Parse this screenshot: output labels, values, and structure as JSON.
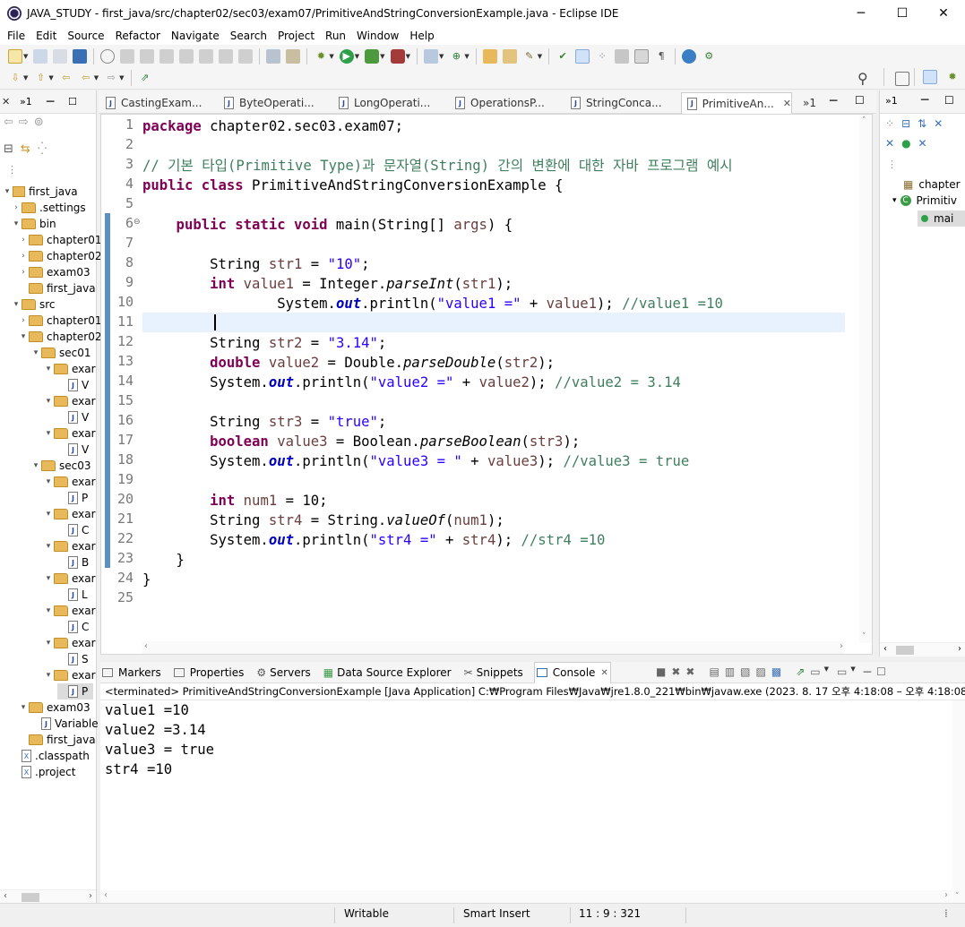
{
  "window": {
    "title": "JAVA_STUDY - first_java/src/chapter02/sec03/exam07/PrimitiveAndStringConversionExample.java - Eclipse IDE",
    "minimize": "─",
    "maximize": "☐",
    "close": "✕"
  },
  "menu": [
    "File",
    "Edit",
    "Source",
    "Refactor",
    "Navigate",
    "Search",
    "Project",
    "Run",
    "Window",
    "Help"
  ],
  "explorer": {
    "tab_glyph": "»1",
    "items": [
      {
        "label": "first_java",
        "depth": 0,
        "kind": "project",
        "twisty": "▾"
      },
      {
        "label": ".settings",
        "depth": 1,
        "kind": "folder",
        "twisty": "›"
      },
      {
        "label": "bin",
        "depth": 1,
        "kind": "folder",
        "twisty": "▾"
      },
      {
        "label": "chapter01",
        "depth": 2,
        "kind": "folder",
        "twisty": "›"
      },
      {
        "label": "chapter02",
        "depth": 2,
        "kind": "folder",
        "twisty": "›"
      },
      {
        "label": "exam03",
        "depth": 2,
        "kind": "folder",
        "twisty": "›"
      },
      {
        "label": "first_java",
        "depth": 2,
        "kind": "folder",
        "twisty": ""
      },
      {
        "label": "src",
        "depth": 1,
        "kind": "folder",
        "twisty": "▾"
      },
      {
        "label": "chapter01",
        "depth": 2,
        "kind": "folder",
        "twisty": "›"
      },
      {
        "label": "chapter02",
        "depth": 2,
        "kind": "folder",
        "twisty": "▾"
      },
      {
        "label": "sec01",
        "depth": 3,
        "kind": "folder",
        "twisty": "▾"
      },
      {
        "label": "exar",
        "depth": 4,
        "kind": "folder",
        "twisty": "▾"
      },
      {
        "label": "V",
        "depth": 5,
        "kind": "java",
        "twisty": ""
      },
      {
        "label": "exar",
        "depth": 4,
        "kind": "folder",
        "twisty": "▾"
      },
      {
        "label": "V",
        "depth": 5,
        "kind": "java",
        "twisty": ""
      },
      {
        "label": "exar",
        "depth": 4,
        "kind": "folder",
        "twisty": "▾"
      },
      {
        "label": "V",
        "depth": 5,
        "kind": "java",
        "twisty": ""
      },
      {
        "label": "sec03",
        "depth": 3,
        "kind": "folder",
        "twisty": "▾"
      },
      {
        "label": "exar",
        "depth": 4,
        "kind": "folder",
        "twisty": "▾"
      },
      {
        "label": "P",
        "depth": 5,
        "kind": "java",
        "twisty": ""
      },
      {
        "label": "exar",
        "depth": 4,
        "kind": "folder",
        "twisty": "▾"
      },
      {
        "label": "C",
        "depth": 5,
        "kind": "java",
        "twisty": ""
      },
      {
        "label": "exar",
        "depth": 4,
        "kind": "folder",
        "twisty": "▾"
      },
      {
        "label": "B",
        "depth": 5,
        "kind": "java",
        "twisty": ""
      },
      {
        "label": "exar",
        "depth": 4,
        "kind": "folder",
        "twisty": "▾"
      },
      {
        "label": "L",
        "depth": 5,
        "kind": "java",
        "twisty": ""
      },
      {
        "label": "exar",
        "depth": 4,
        "kind": "folder",
        "twisty": "▾"
      },
      {
        "label": "C",
        "depth": 5,
        "kind": "java",
        "twisty": ""
      },
      {
        "label": "exar",
        "depth": 4,
        "kind": "folder",
        "twisty": "▾"
      },
      {
        "label": "S",
        "depth": 5,
        "kind": "java",
        "twisty": ""
      },
      {
        "label": "exar",
        "depth": 4,
        "kind": "folder",
        "twisty": "▾"
      },
      {
        "label": "P",
        "depth": 5,
        "kind": "java",
        "twisty": "",
        "selected": true
      },
      {
        "label": "exam03",
        "depth": 2,
        "kind": "folder",
        "twisty": "▾"
      },
      {
        "label": "Variable",
        "depth": 3,
        "kind": "java",
        "twisty": ""
      },
      {
        "label": "first_java",
        "depth": 2,
        "kind": "folder",
        "twisty": ""
      },
      {
        "label": ".classpath",
        "depth": 1,
        "kind": "xml",
        "twisty": ""
      },
      {
        "label": ".project",
        "depth": 1,
        "kind": "xml",
        "twisty": ""
      }
    ]
  },
  "editor_tabs": [
    {
      "label": "CastingExam...",
      "active": false
    },
    {
      "label": "ByteOperati...",
      "active": false
    },
    {
      "label": "LongOperati...",
      "active": false
    },
    {
      "label": "OperationsP...",
      "active": false
    },
    {
      "label": "StringConca...",
      "active": false
    },
    {
      "label": "PrimitiveAn...",
      "active": true,
      "close": "✕"
    },
    {
      "label": "»1",
      "active": false
    }
  ],
  "code": [
    "1",
    "2",
    "3",
    "4",
    "5",
    "6",
    "7",
    "8",
    "9",
    "10",
    "11",
    "12",
    "13",
    "14",
    "15",
    "16",
    "17",
    "18",
    "19",
    "20",
    "21",
    "22",
    "23",
    "24",
    "25"
  ],
  "code_text": {
    "l1a": "package",
    "l1b": " chapter02.sec03.exam07;",
    "l3": "// 기본 타입(Primitive Type)과 문자열(String) 간의 변환에 대한 자바 프로그램 예시",
    "l4a": "public class",
    "l4b": " PrimitiveAndStringConversionExample {",
    "l6a": "    public static void",
    "l6b": " main(String[] ",
    "l6c": "args",
    "l6d": ") {",
    "l8a": "        String ",
    "l8b": "str1",
    "l8c": " = ",
    "l8d": "\"10\"",
    "l8e": ";",
    "l9a": "        int",
    "l9b": " value1",
    "l9c": " = Integer.",
    "l9d": "parseInt",
    "l9e": "(",
    "l9f": "str1",
    "l9g": ");",
    "l10a": "                System.",
    "l10b": "out",
    "l10c": ".println(",
    "l10d": "\"value1 =\"",
    "l10e": " + ",
    "l10f": "value1",
    "l10g": "); ",
    "l10h": "//value1 =10",
    "l12a": "        String ",
    "l12b": "str2",
    "l12c": " = ",
    "l12d": "\"3.14\"",
    "l12e": ";",
    "l13a": "        double",
    "l13b": " value2",
    "l13c": " = Double.",
    "l13d": "parseDouble",
    "l13e": "(",
    "l13f": "str2",
    "l13g": ");",
    "l14a": "        System.",
    "l14b": "out",
    "l14c": ".println(",
    "l14d": "\"value2 =\"",
    "l14e": " + ",
    "l14f": "value2",
    "l14g": "); ",
    "l14h": "//value2 = 3.14",
    "l16a": "        String ",
    "l16b": "str3",
    "l16c": " = ",
    "l16d": "\"true\"",
    "l16e": ";",
    "l17a": "        boolean",
    "l17b": " value3",
    "l17c": " = Boolean.",
    "l17d": "parseBoolean",
    "l17e": "(",
    "l17f": "str3",
    "l17g": ");",
    "l18a": "        System.",
    "l18b": "out",
    "l18c": ".println(",
    "l18d": "\"value3 = \"",
    "l18e": " + ",
    "l18f": "value3",
    "l18g": "); ",
    "l18h": "//value3 = true",
    "l20a": "        int",
    "l20b": " num1",
    "l20c": " = 10;",
    "l21a": "        String ",
    "l21b": "str4",
    "l21c": " = String.",
    "l21d": "valueOf",
    "l21e": "(",
    "l21f": "num1",
    "l21g": ");",
    "l22a": "        System.",
    "l22b": "out",
    "l22c": ".println(",
    "l22d": "\"str4 =\"",
    "l22e": " + ",
    "l22f": "str4",
    "l22g": "); ",
    "l22h": "//str4 =10",
    "l23": "    }",
    "l24": "}"
  },
  "outline": {
    "tab_glyph": "»1",
    "items": [
      "chapter",
      "Primitiv",
      "mai"
    ]
  },
  "console": {
    "tabs": [
      "Markers",
      "Properties",
      "Servers",
      "Data Source Explorer",
      "Snippets",
      "Console"
    ],
    "active": "Console",
    "close": "✕",
    "info": "<terminated> PrimitiveAndStringConversionExample [Java Application] C:₩Program Files₩Java₩jre1.8.0_221₩bin₩javaw.exe  (2023. 8. 17 오후 4:18:08 – 오후 4:18:08)",
    "output": [
      "value1 =10",
      "value2 =3.14",
      "value3 = true",
      "str4 =10"
    ]
  },
  "status": {
    "writable": "Writable",
    "insert": "Smart Insert",
    "position": "11 : 9 : 321"
  },
  "colors": {
    "keyword": "#7f0055",
    "string": "#2a00ff",
    "comment": "#3f7f5f",
    "field": "#0000c0"
  }
}
